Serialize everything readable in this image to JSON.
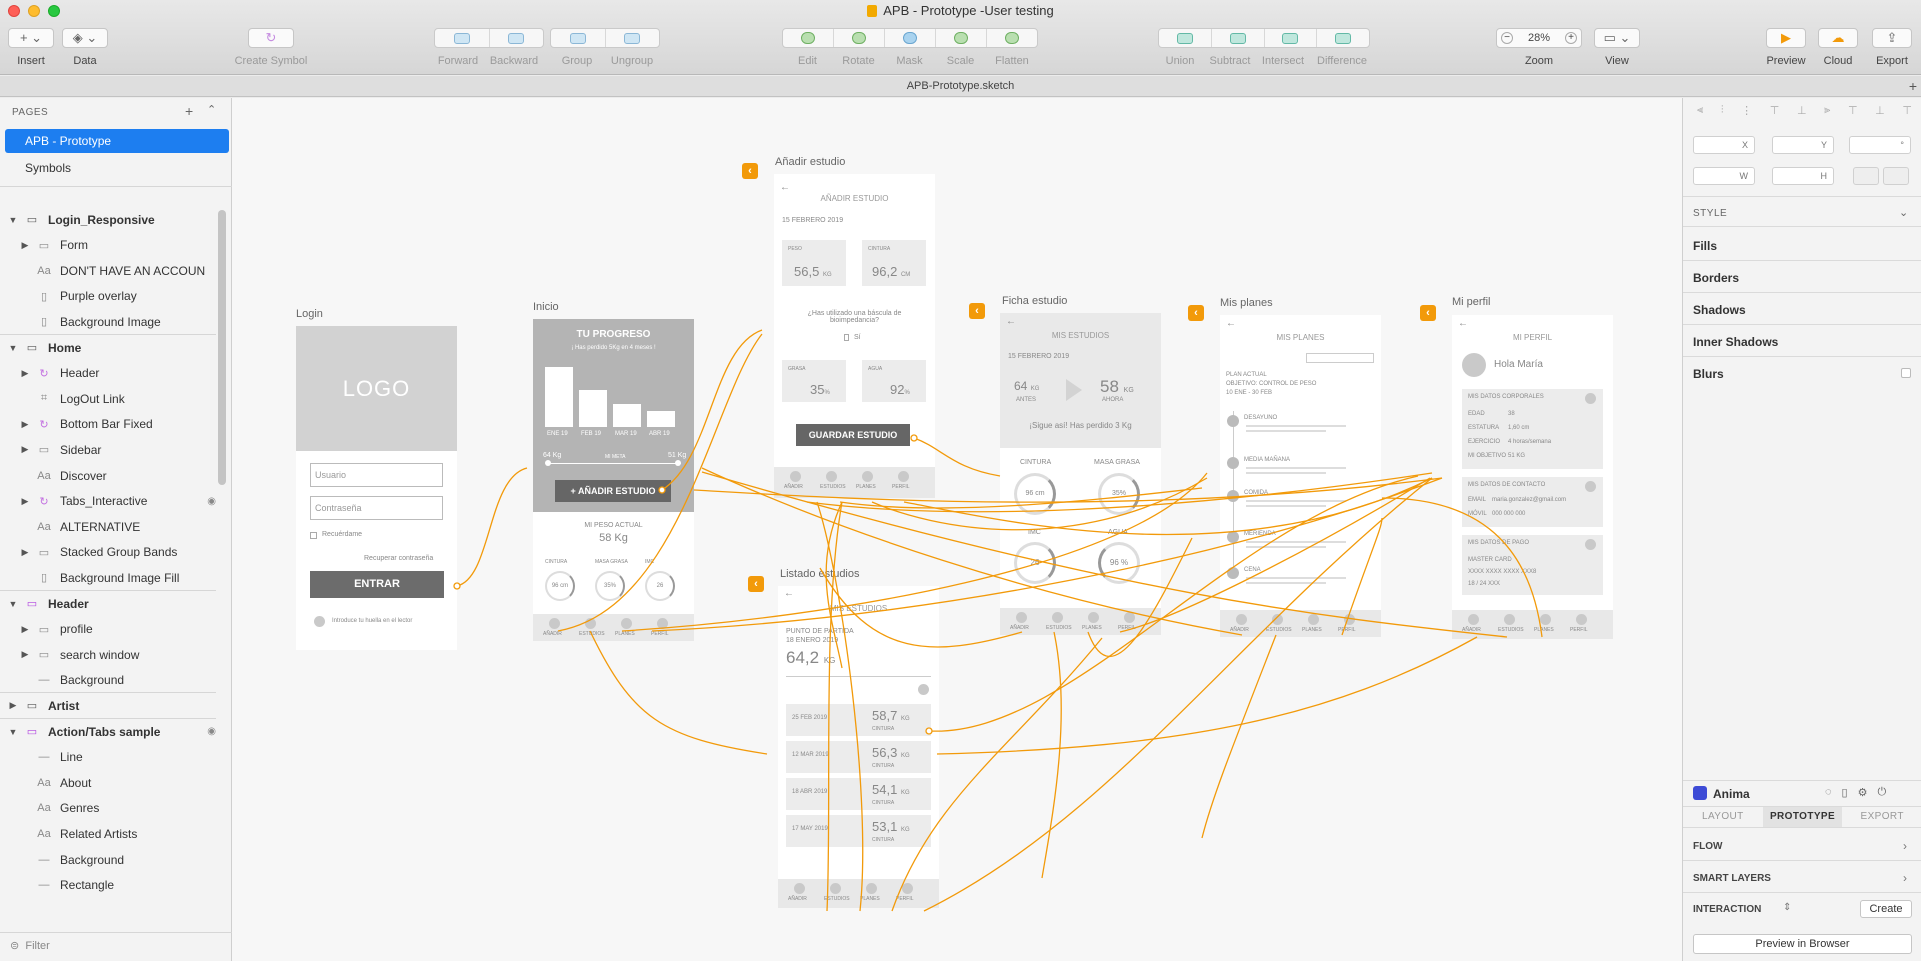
{
  "window": {
    "title": "APB - Prototype -User testing",
    "document": "APB-Prototype.sketch"
  },
  "toolbar": {
    "insert": "Insert",
    "data": "Data",
    "create_symbol": "Create Symbol",
    "forward": "Forward",
    "backward": "Backward",
    "group": "Group",
    "ungroup": "Ungroup",
    "edit": "Edit",
    "rotate": "Rotate",
    "mask": "Mask",
    "scale": "Scale",
    "flatten": "Flatten",
    "union": "Union",
    "subtract": "Subtract",
    "intersect": "Intersect",
    "difference": "Difference",
    "zoom_label": "Zoom",
    "zoom_value": "28%",
    "view": "View",
    "preview": "Preview",
    "cloud": "Cloud",
    "export": "Export"
  },
  "pages": {
    "header": "PAGES",
    "items": [
      "APB - Prototype",
      "Symbols"
    ],
    "selected": "APB - Prototype"
  },
  "layers": [
    {
      "label": "Login_Responsive",
      "type": "artboard"
    },
    {
      "label": "Form",
      "type": "folder"
    },
    {
      "label": "DON'T HAVE AN ACCOUN",
      "type": "text"
    },
    {
      "label": "Purple overlay",
      "type": "rect"
    },
    {
      "label": "Background Image",
      "type": "rect"
    },
    {
      "label": "Home",
      "type": "artboard"
    },
    {
      "label": "Header",
      "type": "symbol"
    },
    {
      "label": "LogOut Link",
      "type": "link"
    },
    {
      "label": "Bottom Bar Fixed",
      "type": "symbol"
    },
    {
      "label": "Sidebar",
      "type": "folder"
    },
    {
      "label": "Discover",
      "type": "text"
    },
    {
      "label": "Tabs_Interactive",
      "type": "symbol"
    },
    {
      "label": "ALTERNATIVE",
      "type": "text"
    },
    {
      "label": "Stacked Group Bands",
      "type": "folder"
    },
    {
      "label": "Background Image Fill",
      "type": "rect"
    },
    {
      "label": "Header",
      "type": "artboard"
    },
    {
      "label": "profile",
      "type": "folder"
    },
    {
      "label": "search window",
      "type": "folder"
    },
    {
      "label": "Background",
      "type": "line"
    },
    {
      "label": "Artist",
      "type": "artboard"
    },
    {
      "label": "Action/Tabs sample",
      "type": "artboard"
    },
    {
      "label": "Line",
      "type": "line"
    },
    {
      "label": "About",
      "type": "text"
    },
    {
      "label": "Genres",
      "type": "text"
    },
    {
      "label": "Related Artists",
      "type": "text"
    },
    {
      "label": "Background",
      "type": "line"
    },
    {
      "label": "Rectangle",
      "type": "line"
    }
  ],
  "filter_placeholder": "Filter",
  "artboards": {
    "login": {
      "label": "Login",
      "logo": "LOGO",
      "user": "Usuario",
      "pass": "Contraseña",
      "remember": "Recuérdame",
      "recover": "Recuperar contraseña",
      "enter": "ENTRAR",
      "fingerprint": "Introduce tu huella en el lector"
    },
    "inicio": {
      "label": "Inicio",
      "title": "TU PROGRESO",
      "subtitle": "¡ Has perdido 5Kg en 4 meses !",
      "months": [
        "ENE 19",
        "FEB 19",
        "MAR 19",
        "ABR 19"
      ],
      "bar_values": [
        1.0,
        0.62,
        0.38,
        0.26
      ],
      "start": "64 Kg",
      "goal_lbl": "MI META",
      "end": "51 Kg",
      "add": "+ AÑADIR ESTUDIO",
      "peso_lbl": "MI PESO ACTUAL",
      "peso": "58 Kg",
      "gauges": [
        {
          "l": "CINTURA",
          "v": "96 cm"
        },
        {
          "l": "MASA GRASA",
          "v": "35%"
        },
        {
          "l": "IMC",
          "v": "26"
        }
      ]
    },
    "anadir": {
      "label": "Añadir estudio",
      "title": "AÑADIR ESTUDIO",
      "date": "15 FEBRERO 2019",
      "peso_l": "PESO",
      "peso": "56,5",
      "peso_u": "KG",
      "cint_l": "CINTURA",
      "cint": "96,2",
      "cint_u": "CM",
      "q": "¿Has utilizado una báscula de bioimpedancia?",
      "si": "Sí",
      "grasa_l": "GRASA",
      "grasa": "35",
      "agua_l": "AGUA",
      "agua": "92",
      "pct": "%",
      "save": "GUARDAR ESTUDIO"
    },
    "listado": {
      "label": "Listado estudios",
      "title": "MIS ESTUDIOS",
      "start": "PUNTO DE PARTIDA",
      "date": "18 ENERO 2019",
      "peso": "64,2",
      "u": "KG",
      "rows": [
        {
          "d": "25 FEB 2019",
          "w": "58,7"
        },
        {
          "d": "12 MAR 2019",
          "w": "56,3"
        },
        {
          "d": "18 ABR 2019",
          "w": "54,1"
        },
        {
          "d": "17 MAY 2019",
          "w": "53,1"
        }
      ],
      "cint": "CINTURA"
    },
    "ficha": {
      "label": "Ficha estudio",
      "title": "MIS ESTUDIOS",
      "date": "15 FEBRERO 2019",
      "antes": "64",
      "antes_u": "KG",
      "antes_l": "ANTES",
      "ahora": "58",
      "ahora_u": "KG",
      "ahora_l": "AHORA",
      "msg": "¡Sigue así! Has perdido 3 Kg",
      "g1": "CINTURA",
      "g2": "MASA GRASA",
      "v1": "96 cm",
      "v2": "35%",
      "g3": "IMC",
      "g4": "AGUA",
      "v3": "26",
      "v4": "96 %"
    },
    "planes": {
      "label": "Mis planes",
      "title": "MIS PLANES",
      "plan": "PLAN ACTUAL",
      "obj": "OBJETIVO: CONTROL DE PESO",
      "range": "10 ENE - 30 FEB",
      "meals": [
        "DESAYUNO",
        "MEDIA MAÑANA",
        "COMIDA",
        "MERIENDA",
        "CENA"
      ]
    },
    "perfil": {
      "label": "Mi perfil",
      "title": "MI PERFIL",
      "hola": "Hola María",
      "corp": "MIS DATOS CORPORALES",
      "edad_l": "EDAD",
      "edad": "38",
      "est_l": "ESTATURA",
      "est": "1,60 cm",
      "ej_l": "EJERCICIO",
      "ej": "4 horas/semana",
      "obj_l": "MI OBJETIVO",
      "obj": "51 KG",
      "cont": "MIS DATOS DE CONTACTO",
      "email_l": "EMAIL",
      "email": "maria.gonzalez@gmail.com",
      "movil_l": "MÓVIL",
      "movil": "000 000 000",
      "pago": "MIS DATOS DE PAGO",
      "card": "MASTER CARD",
      "num": "XXXX  XXXX  XXXX  XXX8",
      "exp": "18 / 24       XXX"
    },
    "tabs": [
      "AÑADIR",
      "ESTUDIOS",
      "PLANES",
      "PERFIL"
    ]
  },
  "inspector": {
    "x": "X",
    "y": "Y",
    "w": "W",
    "h": "H",
    "deg": "°",
    "style": "STYLE",
    "fills": "Fills",
    "borders": "Borders",
    "shadows": "Shadows",
    "inner_shadows": "Inner Shadows",
    "blurs": "Blurs",
    "anima": "Anima",
    "tab_layout": "LAYOUT",
    "tab_prototype": "PROTOTYPE",
    "tab_export": "EXPORT",
    "flow": "FLOW",
    "smart_layers": "SMART LAYERS",
    "interaction": "INTERACTION",
    "create": "Create",
    "preview_browser": "Preview in Browser"
  },
  "colors": {
    "accent": "#f29a0a",
    "selection": "#1d7ef0",
    "anima": "#3d4bd6"
  }
}
